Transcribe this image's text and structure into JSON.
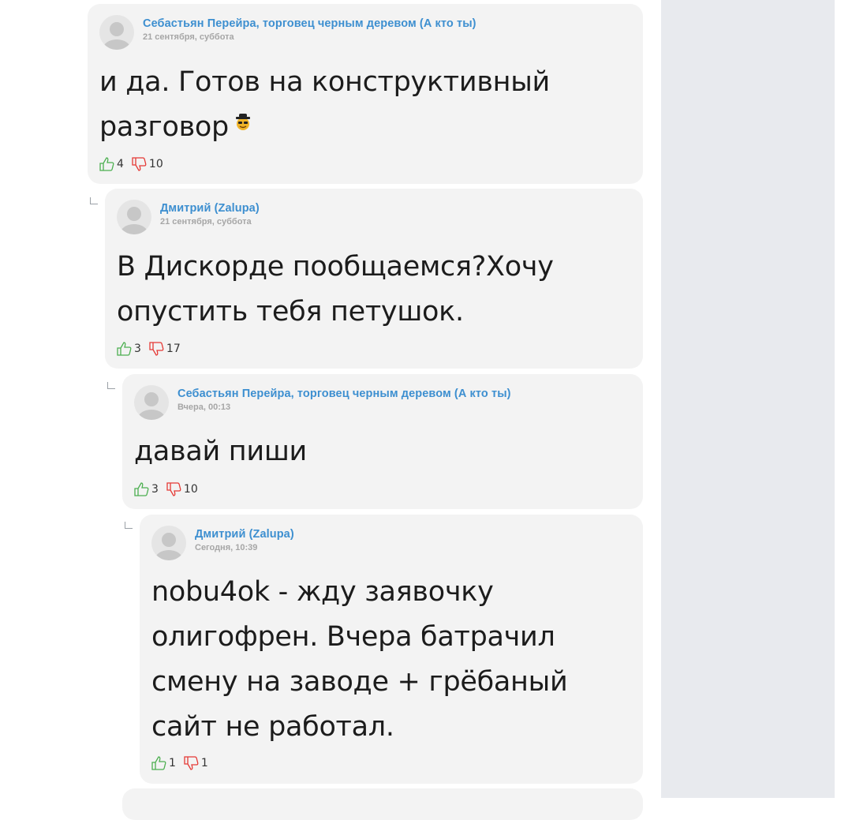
{
  "comments": [
    {
      "author": "Себастьян Перейра, торговец черным деревом (А кто ты)",
      "date": "21 сентября, суббота",
      "text": "и да. Готов на конструктивный разговор",
      "emoji": "sunglasses-hat-emoji",
      "likes": "4",
      "dislikes": "10"
    },
    {
      "author": "Дмитрий (Zalupa)",
      "date": "21 сентября, суббота",
      "text": "В Дискорде пообщаемся?Хочу опустить тебя петушок.",
      "likes": "3",
      "dislikes": "17"
    },
    {
      "author": "Себастьян Перейра, торговец черным деревом (А кто ты)",
      "date": "Вчера, 00:13",
      "text": "давай пиши",
      "likes": "3",
      "dislikes": "10"
    },
    {
      "author": "Дмитрий (Zalupa)",
      "date": "Сегодня, 10:39",
      "text": "nobu4ok - жду заявочку олигофрен. Вчера батрачил смену на заводе + грёбаный сайт не работал.",
      "likes": "1",
      "dislikes": "1"
    }
  ],
  "colors": {
    "author": "#3d8fd0",
    "like": "#4caf50",
    "dislike": "#e53935",
    "card": "#f3f3f3",
    "sidebar": "#e8eaee"
  }
}
